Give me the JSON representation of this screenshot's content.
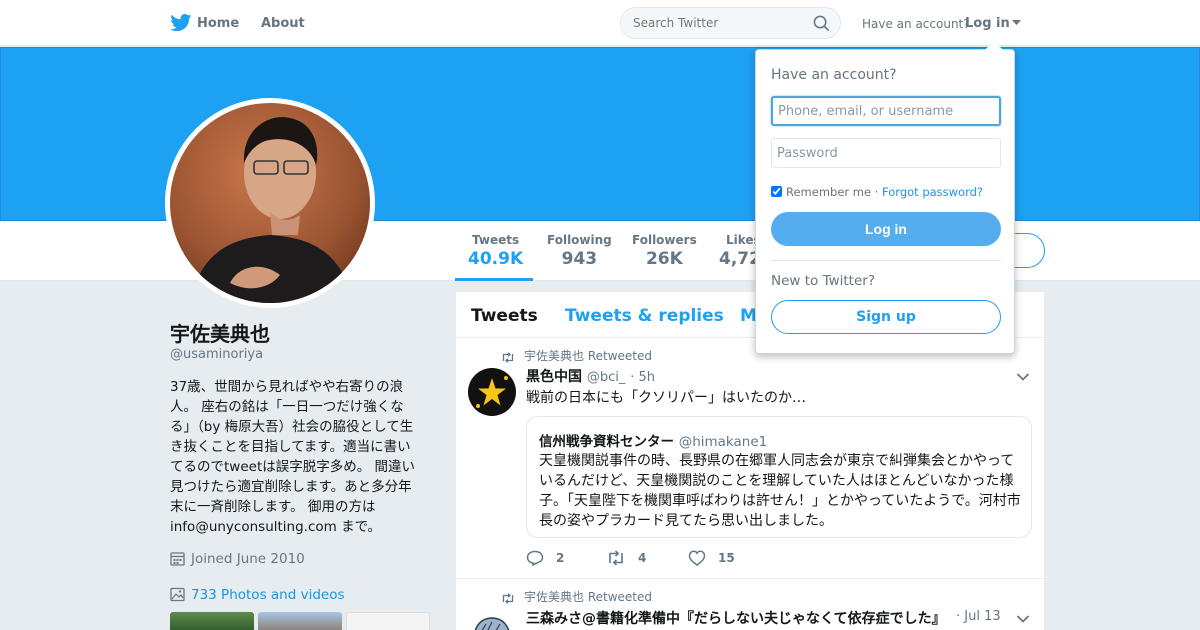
{
  "nav": {
    "home": "Home",
    "about": "About",
    "search_placeholder": "Search Twitter",
    "have_account": "Have an account?",
    "login": "Log in"
  },
  "profile": {
    "name": "宇佐美典也",
    "handle": "@usaminoriya",
    "bio_lines": [
      "37歳、世間から見ればやや右寄りの浪",
      "人。 座右の銘は「一日一つだけ強くな",
      "る」（by 梅原大吾）社会の脇役として生",
      "き抜くことを目指してます。適当に書い",
      "てるのでtweetは誤字脱字多め。 間違い",
      "見つけたら適宜削除します。あと多分年",
      "末に一斉削除します。 御用の方は",
      "info@unyconsulting.com まで。"
    ],
    "joined": "Joined June 2010",
    "photos": "733 Photos and videos"
  },
  "stats": [
    {
      "label": "Tweets",
      "value": "40.9K"
    },
    {
      "label": "Following",
      "value": "943"
    },
    {
      "label": "Followers",
      "value": "26K"
    },
    {
      "label": "Likes",
      "value": "4,72"
    }
  ],
  "tabs": [
    "Tweets",
    "Tweets & replies",
    "M"
  ],
  "tweets": [
    {
      "retweeted_by": "宇佐美典也 Retweeted",
      "author": "黒色中国",
      "handle": "@bci_",
      "time": "· 5h",
      "text": "戦前の日本にも「クソリパー」はいたのか…",
      "quote": {
        "author": "信州戦争資料センター",
        "handle": "@himakane1",
        "text": "天皇機関説事件の時、長野県の在郷軍人同志会が東京で糾弾集会とかやっているんだけど、天皇機関説のことを理解していた人はほとんどいなかった様子。「天皇陛下を機関車呼ばわりは許せん！」とかやっていたようで。河村市長の姿やプラカード見てたら思い出しました。"
      },
      "replies": "2",
      "retweets": "4",
      "likes": "15"
    },
    {
      "retweeted_by": "宇佐美典也 Retweeted",
      "author": "三森みさ@書籍化準備中『だらしない夫じゃなくて依存症でした』",
      "time": "· Jul 13"
    }
  ],
  "login_dropdown": {
    "title": "Have an account?",
    "username_placeholder": "Phone, email, or username",
    "password_placeholder": "Password",
    "remember": "Remember me",
    "separator": "·",
    "forgot": "Forgot password?",
    "login_button": "Log in",
    "new_to": "New to Twitter?",
    "signup": "Sign up"
  },
  "colors": {
    "brand": "#1da1f2",
    "banner": "#1da1f2",
    "login_button": "#55acee",
    "link": "#1b95e0"
  }
}
